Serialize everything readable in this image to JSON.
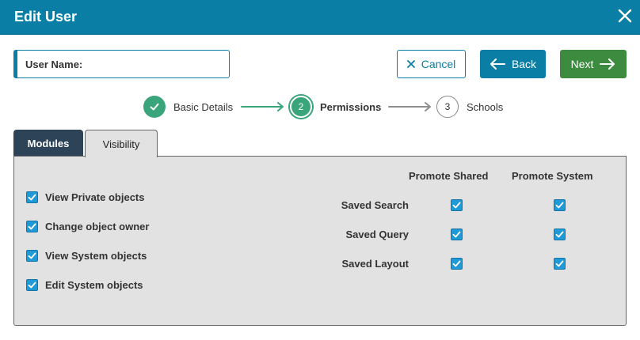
{
  "dialog": {
    "title": "Edit User"
  },
  "user_field": {
    "label": "User Name:",
    "value": ""
  },
  "buttons": {
    "cancel": "Cancel",
    "back": "Back",
    "next": "Next"
  },
  "stepper": {
    "steps": [
      {
        "number": "1",
        "label": "Basic Details",
        "state": "complete"
      },
      {
        "number": "2",
        "label": "Permissions",
        "state": "current"
      },
      {
        "number": "3",
        "label": "Schools",
        "state": "pending"
      }
    ]
  },
  "tabs": [
    {
      "label": "Modules",
      "active": false
    },
    {
      "label": "Visibility",
      "active": true
    }
  ],
  "visibility": {
    "options": [
      {
        "label": "View Private objects",
        "checked": true
      },
      {
        "label": "Change object owner",
        "checked": true
      },
      {
        "label": "View System objects",
        "checked": true
      },
      {
        "label": "Edit System objects",
        "checked": true
      }
    ],
    "promote": {
      "columns": [
        "Promote Shared",
        "Promote System"
      ],
      "rows": [
        {
          "label": "Saved Search",
          "shared": true,
          "system": true
        },
        {
          "label": "Saved Query",
          "shared": true,
          "system": true
        },
        {
          "label": "Saved Layout",
          "shared": true,
          "system": true
        }
      ]
    }
  },
  "colors": {
    "header": "#0a7ea4",
    "next_button": "#3c8b3f",
    "step_complete": "#3aa57b",
    "tab_active_dark": "#2d4357",
    "checkbox": "#1f9ad6",
    "panel": "#e2e2e2"
  },
  "icons": {
    "close": "close-icon",
    "cancel": "x-icon",
    "back": "arrow-left-icon",
    "next": "arrow-right-icon",
    "step_complete": "checkmark-icon"
  }
}
